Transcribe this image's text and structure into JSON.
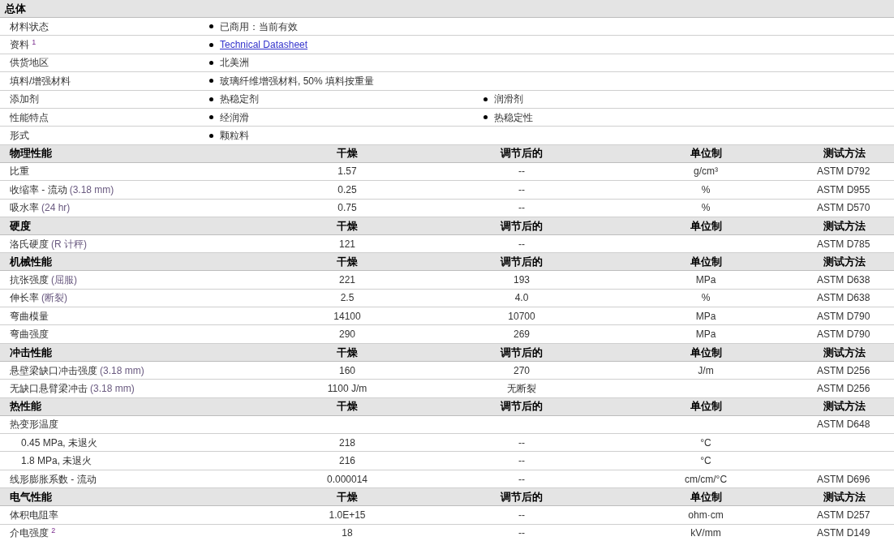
{
  "general": {
    "title": "总体",
    "rows": [
      {
        "label": "材料状态",
        "items": [
          {
            "kind": "text",
            "text": "已商用：当前有效"
          }
        ]
      },
      {
        "label": "资料 $^{1}$",
        "items": [
          {
            "kind": "link",
            "text": "Technical Datasheet"
          }
        ]
      },
      {
        "label": "供货地区",
        "items": [
          {
            "kind": "text",
            "text": "北美洲"
          }
        ]
      },
      {
        "label": "填料/增强材料",
        "items": [
          {
            "kind": "text",
            "text": "玻璃纤维增强材料, 50% 填料按重量"
          }
        ]
      },
      {
        "label": "添加剂",
        "items": [
          {
            "kind": "text",
            "text": "热稳定剂"
          },
          {
            "kind": "text",
            "text": "润滑剂"
          }
        ]
      },
      {
        "label": "性能特点",
        "items": [
          {
            "kind": "text",
            "text": "经润滑"
          },
          {
            "kind": "text",
            "text": "热稳定性"
          }
        ]
      },
      {
        "label": "形式",
        "items": [
          {
            "kind": "text",
            "text": "颗粒料"
          }
        ]
      }
    ]
  },
  "sections": [
    {
      "title": "物理性能",
      "columns": [
        "干燥",
        "调节后的",
        "单位制",
        "测试方法"
      ],
      "rows": [
        {
          "name": "比重",
          "dry": "1.57",
          "conditioned": "--",
          "unit": "g/cm³",
          "method": "ASTM D792"
        },
        {
          "name": "收缩率 - 流动",
          "note": "(3.18 mm)",
          "dry": "0.25",
          "conditioned": "--",
          "unit": "%",
          "method": "ASTM D955"
        },
        {
          "name": "吸水率",
          "note": "(24 hr)",
          "dry": "0.75",
          "conditioned": "--",
          "unit": "%",
          "method": "ASTM D570"
        }
      ]
    },
    {
      "title": "硬度",
      "columns": [
        "干燥",
        "调节后的",
        "单位制",
        "测试方法"
      ],
      "rows": [
        {
          "name": "洛氏硬度",
          "note": "(R 计秤)",
          "dry": "121",
          "conditioned": "--",
          "method": "ASTM D785"
        }
      ]
    },
    {
      "title": "机械性能",
      "columns": [
        "干燥",
        "调节后的",
        "单位制",
        "测试方法"
      ],
      "rows": [
        {
          "name": "抗张强度",
          "note": "(屈服)",
          "dry": "221",
          "conditioned": "193",
          "unit": "MPa",
          "method": "ASTM D638"
        },
        {
          "name": "伸长率",
          "note": "(断裂)",
          "dry": "2.5",
          "conditioned": "4.0",
          "unit": "%",
          "method": "ASTM D638"
        },
        {
          "name": "弯曲模量",
          "dry": "14100",
          "conditioned": "10700",
          "unit": "MPa",
          "method": "ASTM D790"
        },
        {
          "name": "弯曲强度",
          "dry": "290",
          "conditioned": "269",
          "unit": "MPa",
          "method": "ASTM D790"
        }
      ]
    },
    {
      "title": "冲击性能",
      "columns": [
        "干燥",
        "调节后的",
        "单位制",
        "测试方法"
      ],
      "rows": [
        {
          "name": "悬壁梁缺口冲击强度",
          "note": "(3.18 mm)",
          "dry": "160",
          "conditioned": "270",
          "unit": "J/m",
          "method": "ASTM D256"
        },
        {
          "name": "无缺口悬臂梁冲击",
          "note": "(3.18 mm)",
          "dry": "1100 J/m",
          "conditioned": "无断裂",
          "method": "ASTM D256"
        }
      ]
    },
    {
      "title": "热性能",
      "columns": [
        "干燥",
        "调节后的",
        "单位制",
        "测试方法"
      ],
      "rows": [
        {
          "name": "热变形温度",
          "method": "ASTM D648",
          "children": [
            {
              "name": "0.45 MPa, 未退火",
              "dry": "218",
              "conditioned": "--",
              "unit": "°C"
            },
            {
              "name": "1.8 MPa, 未退火",
              "dry": "216",
              "conditioned": "--",
              "unit": "°C"
            }
          ]
        },
        {
          "name": "线形膨胀系数 - 流动",
          "dry": "0.000014",
          "conditioned": "--",
          "unit": "cm/cm/°C",
          "method": "ASTM D696"
        }
      ]
    },
    {
      "title": "电气性能",
      "columns": [
        "干燥",
        "调节后的",
        "单位制",
        "测试方法"
      ],
      "rows": [
        {
          "name": "体积电阻率",
          "dry": "1.0E+15",
          "conditioned": "--",
          "unit": "ohm·cm",
          "method": "ASTM D257"
        },
        {
          "name": "介电强度 $^{2}$",
          "dry": "18",
          "conditioned": "--",
          "unit": "kV/mm",
          "method": "ASTM D149"
        }
      ]
    }
  ]
}
